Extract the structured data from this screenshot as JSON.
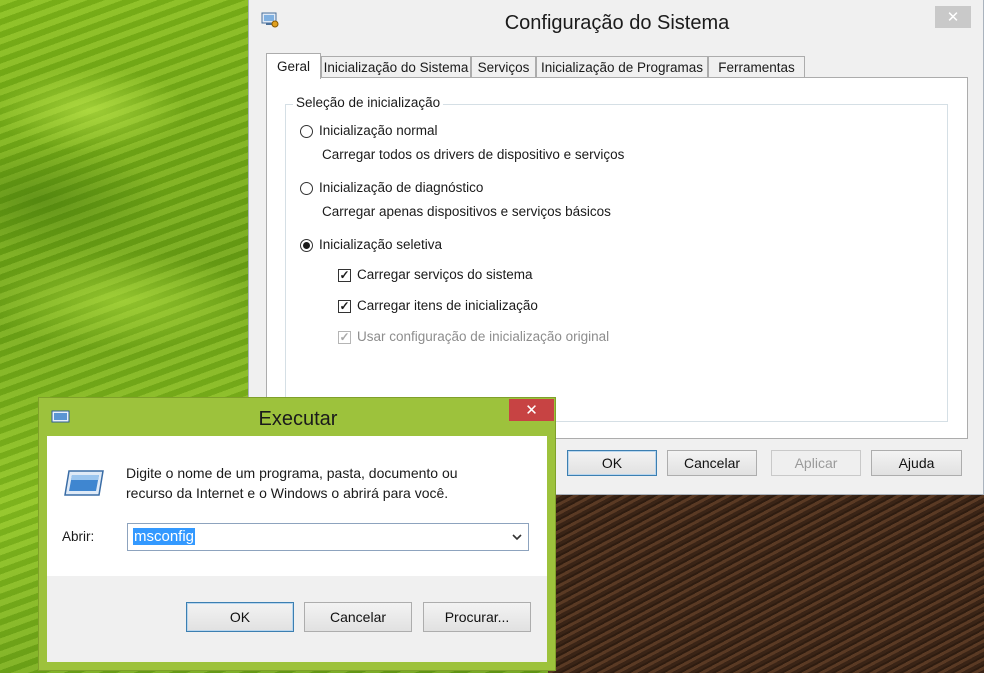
{
  "msconfig": {
    "title": "Configuração do Sistema",
    "tabs": [
      {
        "label": "Geral"
      },
      {
        "label": "Inicialização do Sistema"
      },
      {
        "label": "Serviços"
      },
      {
        "label": "Inicialização de Programas"
      },
      {
        "label": "Ferramentas"
      }
    ],
    "active_tab": "Geral",
    "group_label": "Seleção de inicialização",
    "options": {
      "normal_label": "Inicialização normal",
      "normal_desc": "Carregar todos os drivers de dispositivo e serviços",
      "diagnostic_label": "Inicialização de diagnóstico",
      "diagnostic_desc": "Carregar apenas dispositivos e serviços básicos",
      "selective_label": "Inicialização seletiva",
      "selected": "selective"
    },
    "checkboxes": {
      "services_label": "Carregar serviços do sistema",
      "services_checked": true,
      "startup_label": "Carregar itens de inicialização",
      "startup_checked": true,
      "original_label": "Usar configuração de inicialização original",
      "original_checked": true,
      "original_enabled": false
    },
    "buttons": {
      "ok": "OK",
      "cancel": "Cancelar",
      "apply": "Aplicar",
      "help": "Ajuda"
    },
    "close_glyph": "✕"
  },
  "run": {
    "title": "Executar",
    "description": "Digite o nome de um programa, pasta, documento ou recurso da Internet e o Windows o abrirá para você.",
    "open_label": "Abrir:",
    "open_value": "msconfig",
    "buttons": {
      "ok": "OK",
      "cancel": "Cancelar",
      "browse": "Procurar..."
    },
    "close_glyph": "✕"
  },
  "colors": {
    "run_frame": "#9dc23c",
    "close_red": "#c74343",
    "selection": "#3399ff"
  }
}
